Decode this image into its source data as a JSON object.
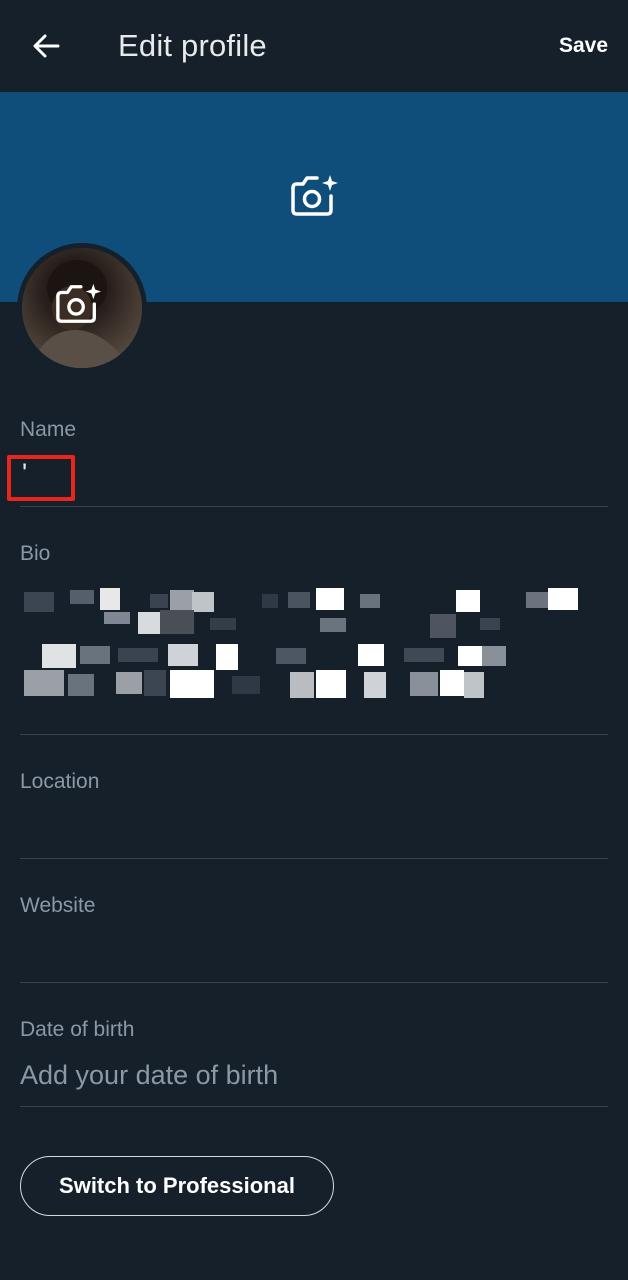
{
  "header": {
    "title": "Edit profile",
    "save_label": "Save"
  },
  "icons": {
    "back": "arrow-left-icon",
    "banner_camera": "add-photo-icon",
    "avatar_camera": "add-photo-icon"
  },
  "colors": {
    "background": "#15202b",
    "banner": "#0f4e7a",
    "divider": "#38444d",
    "label": "#8b98a5",
    "highlight": "#e8261c"
  },
  "fields": {
    "name": {
      "label": "Name",
      "value": "'"
    },
    "bio": {
      "label": "Bio"
    },
    "location": {
      "label": "Location",
      "value": ""
    },
    "website": {
      "label": "Website",
      "value": ""
    },
    "dob": {
      "label": "Date of birth",
      "placeholder": "Add your date of birth"
    }
  },
  "professional_button": {
    "label": "Switch to Professional"
  }
}
